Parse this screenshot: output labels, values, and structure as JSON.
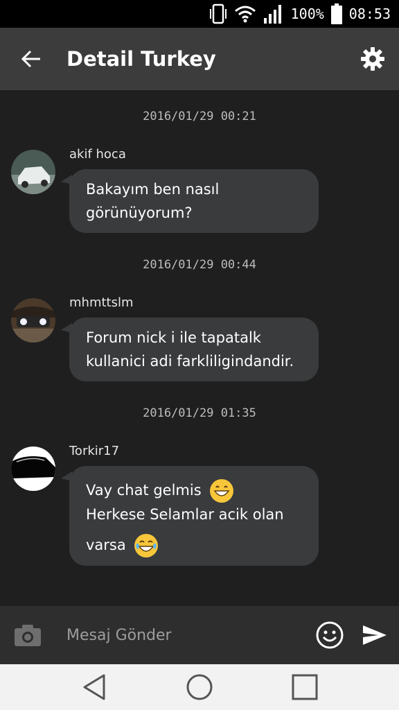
{
  "status_bar": {
    "battery_percent": "100%",
    "time": "08:53",
    "icons": [
      "phone-vibrate-icon",
      "wifi-icon",
      "signal-icon",
      "battery-icon"
    ]
  },
  "app_bar": {
    "title": "Detail Turkey",
    "back_icon": "arrow-back-icon",
    "settings_icon": "gear-icon"
  },
  "messages": [
    {
      "timestamp": "2016/01/29 00:21",
      "sender": "akif hoca",
      "lines": [
        "Bakayım ben nasıl",
        "görünüyorum?"
      ]
    },
    {
      "timestamp": "2016/01/29 00:44",
      "sender": "mhmttslm",
      "lines": [
        "Forum nick i ile tapatalk",
        "kullanici adi farkliligindandir."
      ]
    },
    {
      "timestamp": "2016/01/29 01:35",
      "sender": "Torkir17",
      "lines": [
        "Vay chat gelmis",
        "Herkese Selamlar acik olan",
        "varsa"
      ],
      "emojis": [
        "grinning-face-icon",
        "tears-of-joy-icon"
      ]
    }
  ],
  "input_bar": {
    "placeholder": "Mesaj Gönder",
    "camera_icon": "camera-icon",
    "emoji_icon": "emoji-icon",
    "send_icon": "send-icon"
  },
  "nav_bar": {
    "icons": [
      "nav-back-icon",
      "nav-home-icon",
      "nav-recents-icon"
    ]
  },
  "colors": {
    "app_bar": "#3c3c3c",
    "background": "#1f1f1f",
    "bubble": "#3a3b3d",
    "emoji": "#f7c63a"
  }
}
